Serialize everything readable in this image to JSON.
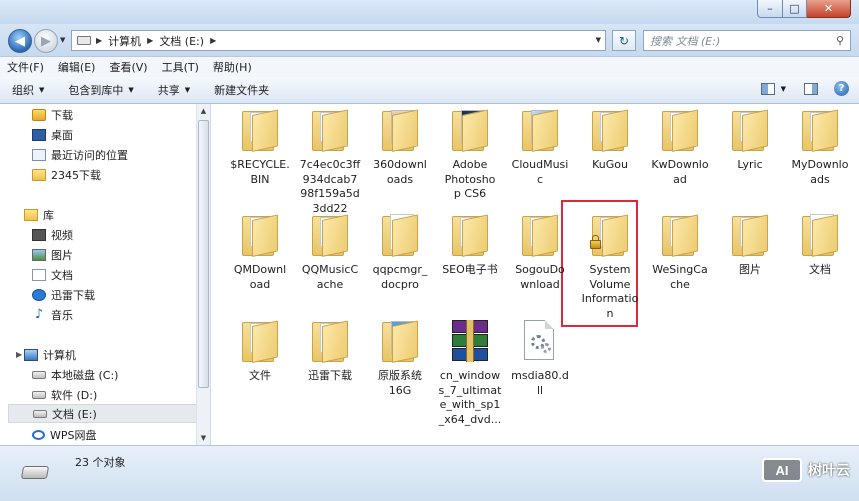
{
  "address": {
    "crumbs": [
      "计算机",
      "文档 (E:)"
    ],
    "search_placeholder": "搜索 文档 (E:)"
  },
  "menu": [
    "文件(F)",
    "编辑(E)",
    "查看(V)",
    "工具(T)",
    "帮助(H)"
  ],
  "commands": {
    "organize": "组织",
    "include_in_library": "包含到库中",
    "share": "共享",
    "new_folder": "新建文件夹"
  },
  "nav": {
    "favorites": [
      {
        "label": "下载",
        "icon": "download-icon"
      },
      {
        "label": "桌面",
        "icon": "desktop-icon"
      },
      {
        "label": "最近访问的位置",
        "icon": "recent-places-icon"
      },
      {
        "label": "2345下载",
        "icon": "folder-icon"
      }
    ],
    "libraries_label": "库",
    "libraries": [
      {
        "label": "视频",
        "icon": "video-icon"
      },
      {
        "label": "图片",
        "icon": "pictures-icon"
      },
      {
        "label": "文档",
        "icon": "documents-icon"
      },
      {
        "label": "迅雷下载",
        "icon": "thunder-icon"
      },
      {
        "label": "音乐",
        "icon": "music-icon"
      }
    ],
    "computer_label": "计算机",
    "drives": [
      {
        "label": "本地磁盘 (C:)",
        "selected": false
      },
      {
        "label": "软件 (D:)",
        "selected": false
      },
      {
        "label": "文档 (E:)",
        "selected": true
      },
      {
        "label": "WPS网盘",
        "selected": false
      }
    ]
  },
  "items": [
    {
      "name": "$RECYCLE.BIN",
      "lines": [
        "$RECYCLE.",
        "BIN"
      ],
      "type": "folder"
    },
    {
      "name": "7c4ec0c3ff934dcab798f159a5d3dd22",
      "lines": [
        "7c4ec0c3ff",
        "934dcab7",
        "98f159a5d",
        "3dd22"
      ],
      "type": "folder"
    },
    {
      "name": "360downloads",
      "lines": [
        "360downl",
        "oads"
      ],
      "type": "folder-photo"
    },
    {
      "name": "Adobe Photoshop CS6",
      "lines": [
        "Adobe",
        "Photosho",
        "p CS6"
      ],
      "type": "folder-dark"
    },
    {
      "name": "CloudMusic",
      "lines": [
        "CloudMusi",
        "c"
      ],
      "type": "folder-blue"
    },
    {
      "name": "KuGou",
      "lines": [
        "KuGou"
      ],
      "type": "folder"
    },
    {
      "name": "KwDownload",
      "lines": [
        "KwDownlo",
        "ad"
      ],
      "type": "folder"
    },
    {
      "name": "Lyric",
      "lines": [
        "Lyric"
      ],
      "type": "folder"
    },
    {
      "name": "MyDownloads",
      "lines": [
        "MyDownlo",
        "ads"
      ],
      "type": "folder"
    },
    {
      "name": "QMDownload",
      "lines": [
        "QMDownl",
        "oad"
      ],
      "type": "folder"
    },
    {
      "name": "QQMusicCache",
      "lines": [
        "QQMusicC",
        "ache"
      ],
      "type": "folder"
    },
    {
      "name": "qqpcmgr_docpro",
      "lines": [
        "qqpcmgr_",
        "docpro"
      ],
      "type": "folder-white"
    },
    {
      "name": "SEO电子书",
      "lines": [
        "SEO电子书"
      ],
      "type": "folder"
    },
    {
      "name": "SogouDownload",
      "lines": [
        "SogouDo",
        "wnload"
      ],
      "type": "folder"
    },
    {
      "name": "System Volume Information",
      "lines": [
        "System",
        "Volume",
        "Informatio",
        "n"
      ],
      "type": "folder-locked"
    },
    {
      "name": "WeSingCache",
      "lines": [
        "WeSingCa",
        "che"
      ],
      "type": "folder"
    },
    {
      "name": "图片",
      "lines": [
        "图片"
      ],
      "type": "folder"
    },
    {
      "name": "文档",
      "lines": [
        "文档"
      ],
      "type": "folder-white"
    },
    {
      "name": "文件",
      "lines": [
        "文件"
      ],
      "type": "folder"
    },
    {
      "name": "迅雷下载",
      "lines": [
        "迅雷下载"
      ],
      "type": "folder"
    },
    {
      "name": "原版系统16G",
      "lines": [
        "原版系统",
        "16G"
      ],
      "type": "folder-photo2"
    },
    {
      "name": "cn_windows_7_ultimate_with_sp1_x64_dvd...",
      "lines": [
        "cn_window",
        "s_7_ultimat",
        "e_with_sp1",
        "_x64_dvd..."
      ],
      "type": "winrar"
    },
    {
      "name": "msdia80.dll",
      "lines": [
        "msdia80.d",
        "ll"
      ],
      "type": "dll"
    }
  ],
  "status": {
    "count": "23 个对象"
  },
  "watermark": {
    "badge": "AI",
    "text": "树叶云"
  },
  "colors": {
    "highlight_border": "#e0263a",
    "window_chrome": "#c9dcef"
  }
}
